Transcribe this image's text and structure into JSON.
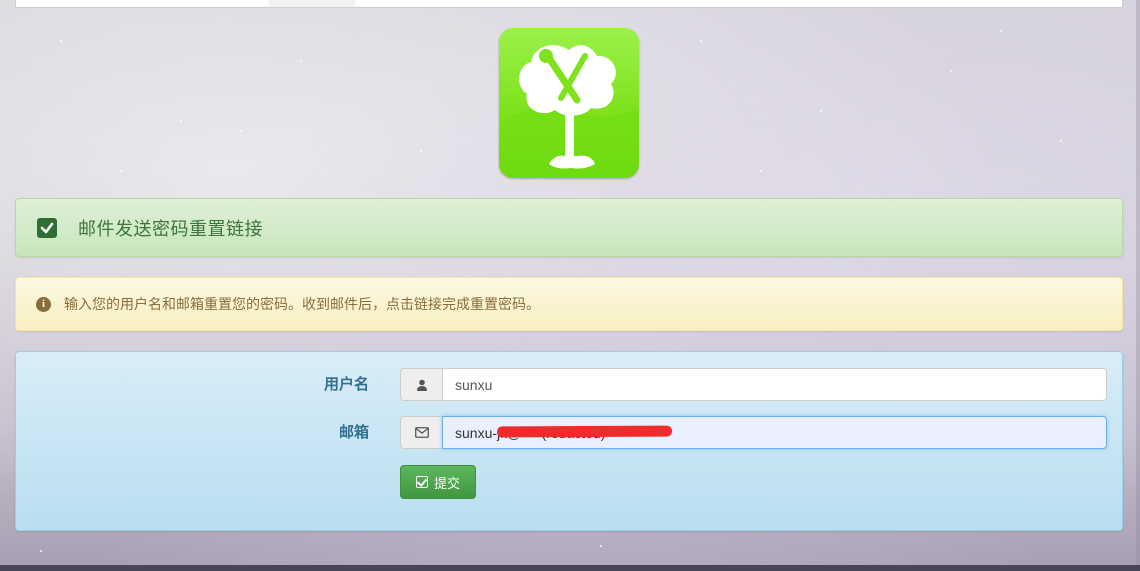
{
  "success_alert": {
    "message": "邮件发送密码重置链接",
    "icon": "check-square-icon"
  },
  "info_alert": {
    "message": "输入您的用户名和邮箱重置您的密码。收到邮件后，点击链接完成重置密码。",
    "icon": "info-circle-icon"
  },
  "form": {
    "username": {
      "label": "用户名",
      "value": "sunxu",
      "icon": "user-icon"
    },
    "email": {
      "label": "邮箱",
      "value": "sunxu-jk@*** (redacted)",
      "icon": "envelope-icon"
    },
    "submit_label": "提交",
    "submit_icon": "edit-icon"
  },
  "colors": {
    "success": "#dff0d8",
    "warning": "#fcf8e3",
    "info": "#d9edf7",
    "button": "#5cb85c"
  }
}
